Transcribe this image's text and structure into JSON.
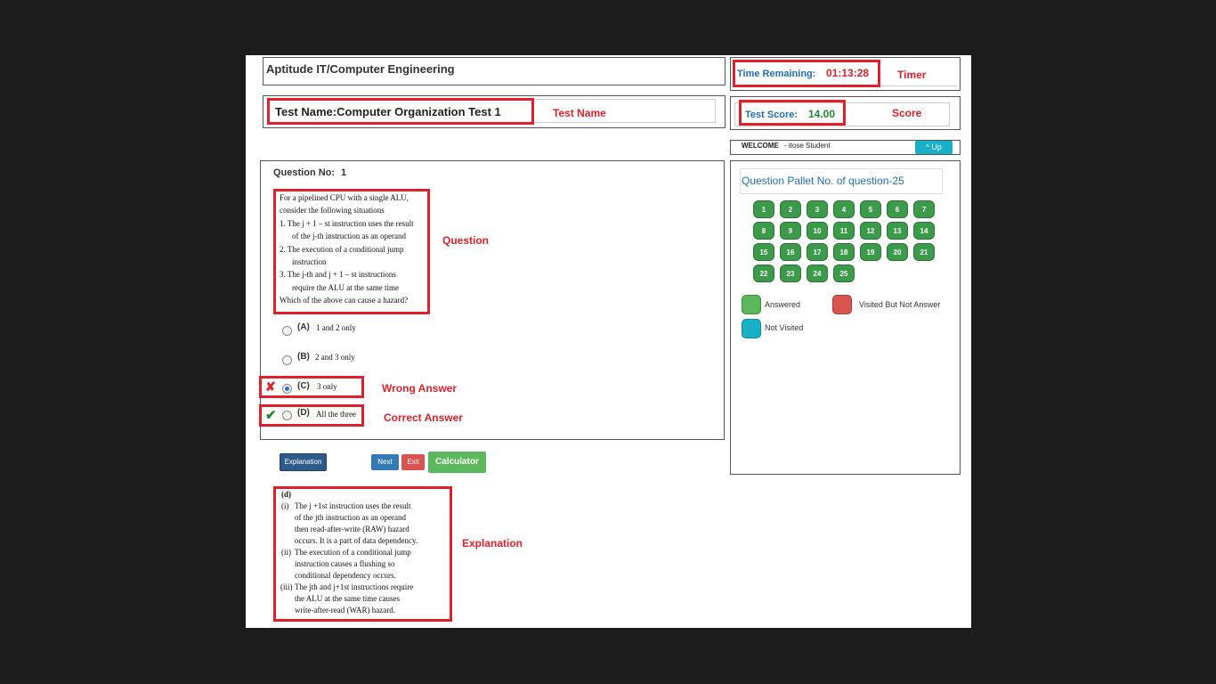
{
  "header": {
    "course_title": "Aptitude IT/Computer Engineering",
    "test_name": "Test Name:Computer Organization Test 1"
  },
  "timer": {
    "label": "Time Remaining:",
    "value": "01:13:28"
  },
  "score": {
    "label": "Test Score:",
    "value": "14.00"
  },
  "welcome": {
    "prefix": "WELCOME",
    "user": "- itose Student",
    "up_label": "Up"
  },
  "annotations": {
    "timer": "Timer",
    "score": "Score",
    "test_name": "Test Name",
    "question": "Question",
    "wrong_answer": "Wrong Answer",
    "correct_answer": "Correct Answer",
    "explanation": "Explanation"
  },
  "question": {
    "label": "Question No:",
    "number": "1",
    "lines": [
      "For a pipelined CPU with a single ALU,",
      "consider the following situations",
      "1.   The j + 1 – st instruction uses the result",
      "of the j-th instruction as an operand",
      "2.   The execution of a conditional jump",
      "instruction",
      "3.   The j-th and j + 1 – st instructions",
      "require the ALU at the same time",
      "Which of the above can cause a hazard?"
    ],
    "options": [
      {
        "letter": "(A)",
        "text": "1 and 2 only"
      },
      {
        "letter": "(B)",
        "text": "2 and 3 only"
      },
      {
        "letter": "(C)",
        "text": "3 only"
      },
      {
        "letter": "(D)",
        "text": "All the three"
      }
    ]
  },
  "buttons": {
    "explanation": "Explanation",
    "next": "Next",
    "exit": "Exit",
    "calculator": "Calculator"
  },
  "explanation": {
    "lines": [
      "(d)",
      "(i)",
      "The j +1st instruction uses the result",
      "of the jth instruction as an operand",
      "then read-after-write (RAW) hazard",
      "occurs. It is a part of data dependency.",
      "(ii)",
      "The execution of a conditional jump",
      "instruction  causes  a  flushing  so",
      "conditional dependency occurs.",
      "(iii)",
      "The jth and j+1st instructions require",
      "the  ALU  at  the  same  time  causes",
      "write-after-read (WAR) hazard."
    ]
  },
  "pallet": {
    "title": "Question Pallet No. of question-25",
    "numbers": [
      "1",
      "2",
      "3",
      "4",
      "5",
      "6",
      "7",
      "8",
      "9",
      "10",
      "11",
      "12",
      "13",
      "14",
      "15",
      "16",
      "17",
      "18",
      "19",
      "20",
      "21",
      "22",
      "23",
      "24",
      "25"
    ],
    "legend": {
      "answered": "Answered",
      "visited": "Visited But Not Answer",
      "not_visited": "Not Visited"
    }
  },
  "colors": {
    "answered": "#5cb85c",
    "visited_not_answered": "#d9534f",
    "not_visited": "#17b0c7",
    "pallet_button": "#3c9b4a",
    "annotation_red": "#e0202a",
    "timer_red": "#d9232d",
    "score_green": "#1e8a2e",
    "label_blue": "#1f6fb2"
  }
}
